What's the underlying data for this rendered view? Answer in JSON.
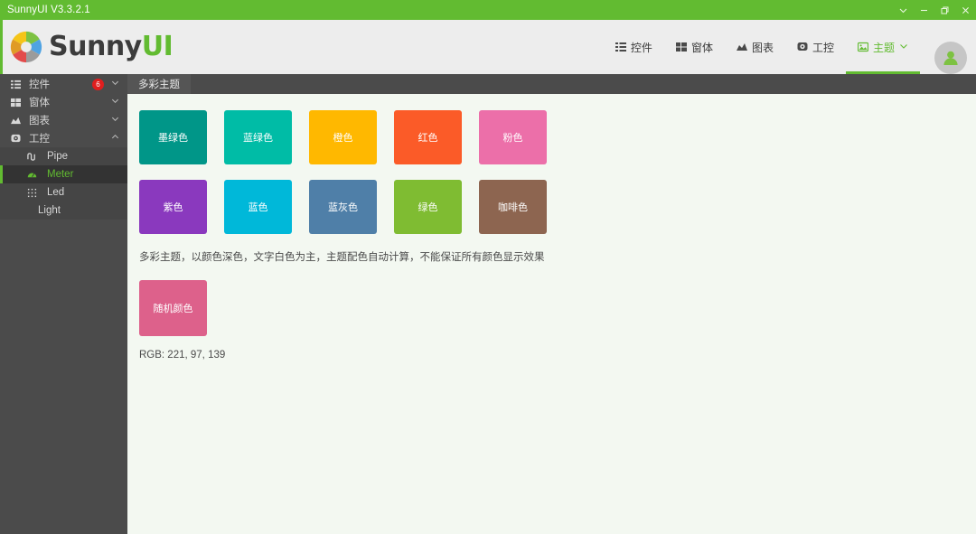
{
  "window": {
    "title": "SunnyUI V3.3.2.1",
    "controls": [
      {
        "name": "chevron-down-icon",
        "label": "⌄"
      },
      {
        "name": "minimize-icon",
        "label": "─"
      },
      {
        "name": "maximize-icon",
        "label": "❐"
      },
      {
        "name": "close-icon",
        "label": "✕"
      }
    ],
    "titlebar_color": "#62BB31"
  },
  "brand": {
    "name_dark": "Sunny",
    "name_accent": "UI",
    "accent_color": "#62BB31",
    "logo_icon": "color-wheel-icon"
  },
  "nav": {
    "items": [
      {
        "label": "控件",
        "icon": "list-grid-icon",
        "active": false
      },
      {
        "label": "窗体",
        "icon": "windows-tiles-icon",
        "active": false
      },
      {
        "label": "图表",
        "icon": "chart-icon",
        "active": false
      },
      {
        "label": "工控",
        "icon": "industrial-control-icon",
        "active": false
      },
      {
        "label": "主题",
        "icon": "theme-image-icon",
        "active": true,
        "chevron": "⌄"
      }
    ],
    "avatar_icon": "user-avatar-icon"
  },
  "sidebar": {
    "items": [
      {
        "label": "控件",
        "icon": "list-grid-icon",
        "badge": "6",
        "chevron": "⌄",
        "expanded": false
      },
      {
        "label": "窗体",
        "icon": "windows-tiles-icon",
        "badge": "",
        "chevron": "⌄",
        "expanded": false
      },
      {
        "label": "图表",
        "icon": "chart-icon",
        "badge": "",
        "chevron": "⌄",
        "expanded": false
      },
      {
        "label": "工控",
        "icon": "industrial-control-icon",
        "badge": "",
        "chevron": "⌃",
        "expanded": true
      }
    ],
    "sub_items": [
      {
        "label": "Pipe",
        "icon": "pipe-icon",
        "selected": false
      },
      {
        "label": "Meter",
        "icon": "meter-gauge-icon",
        "selected": true
      },
      {
        "label": "Led",
        "icon": "led-dots-icon",
        "selected": false
      },
      {
        "label": "Light",
        "icon": "",
        "selected": false
      }
    ]
  },
  "main": {
    "tab_label": "多彩主题",
    "description": "多彩主题，以颜色深色，文字白色为主，主题配色自动计算，不能保证所有颜色显示效果",
    "rgb_label": "RGB: 221, 97, 139",
    "theme_tiles_row1": [
      {
        "label": "墨绿色",
        "color": "#009688"
      },
      {
        "label": "蓝绿色",
        "color": "#00BCA6"
      },
      {
        "label": "橙色",
        "color": "#FFB800"
      },
      {
        "label": "红色",
        "color": "#FB5B28"
      },
      {
        "label": "粉色",
        "color": "#EC6FA9"
      }
    ],
    "theme_tiles_row2": [
      {
        "label": "紫色",
        "color": "#8A39BE"
      },
      {
        "label": "蓝色",
        "color": "#00B8D9"
      },
      {
        "label": "蓝灰色",
        "color": "#4F7FA8"
      },
      {
        "label": "绿色",
        "color": "#7FBC32"
      },
      {
        "label": "咖啡色",
        "color": "#8D6550"
      }
    ],
    "random_tile": {
      "label": "随机颜色",
      "color": "#DD618B"
    }
  }
}
